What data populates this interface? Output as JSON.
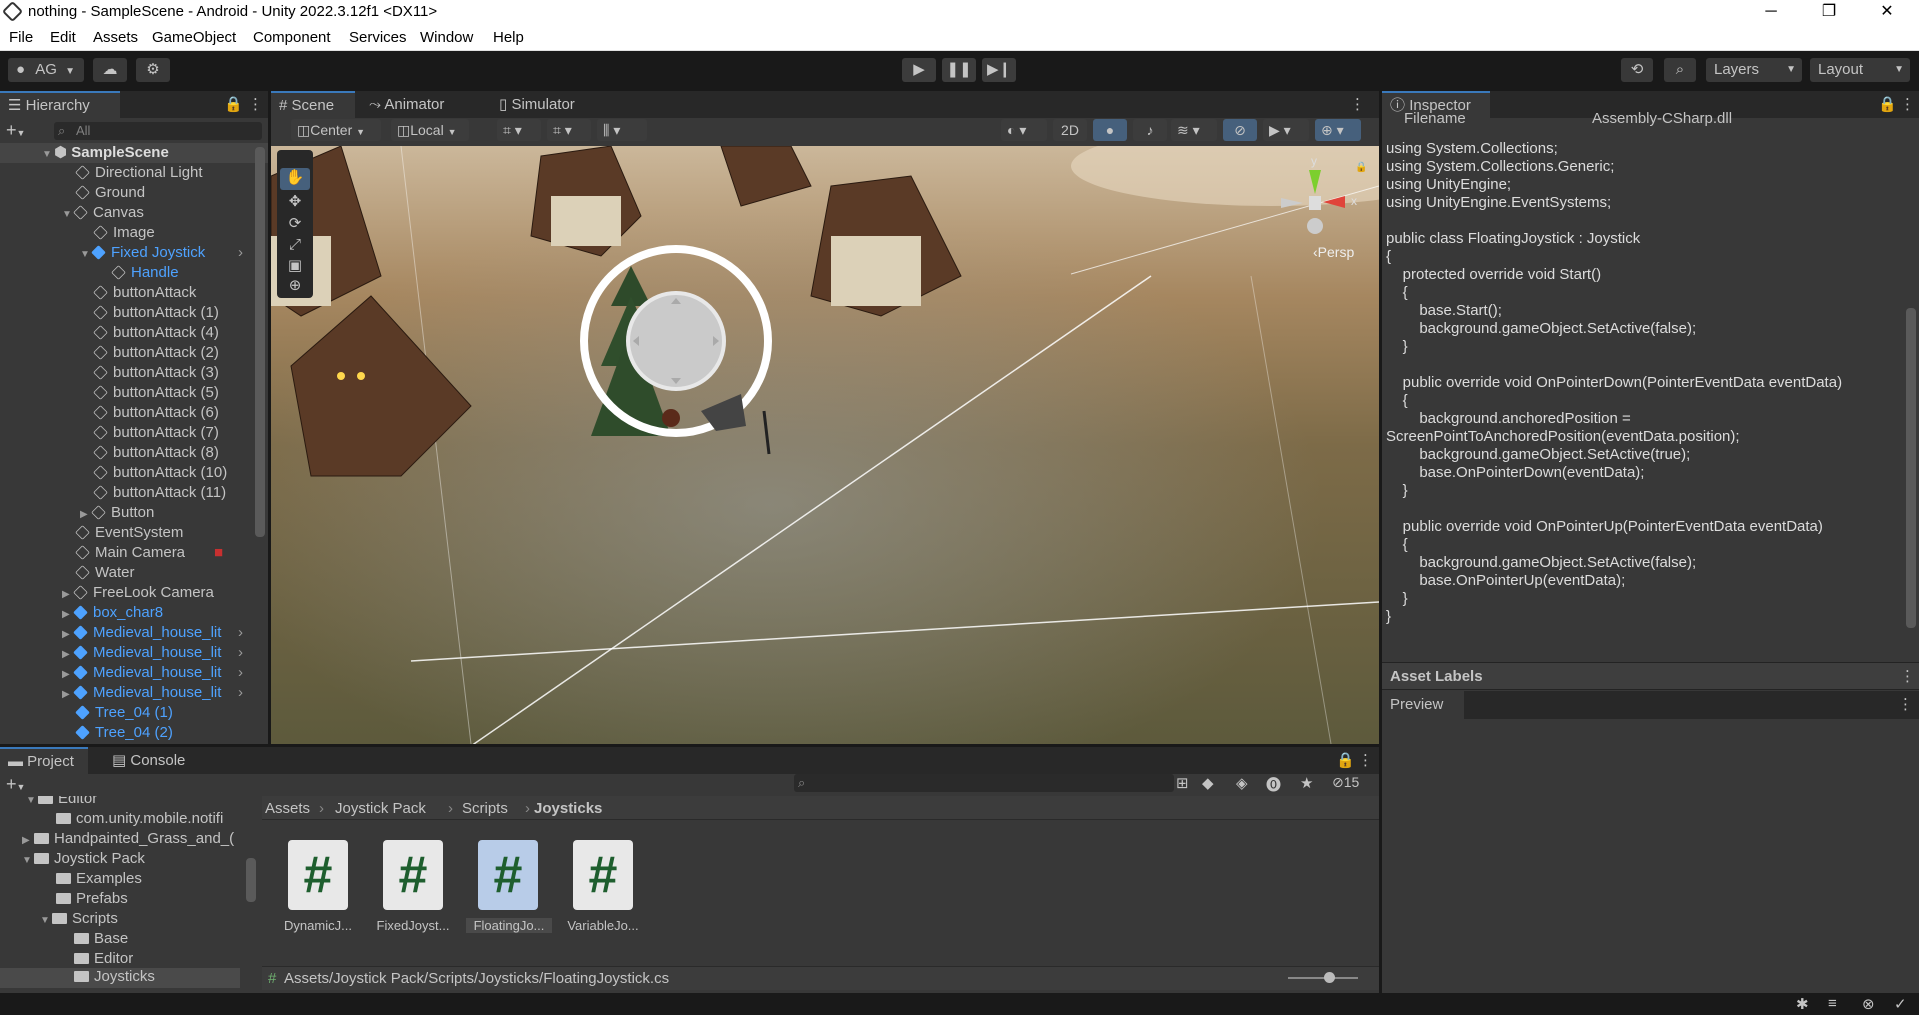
{
  "window": {
    "title": "nothing - SampleScene - Android - Unity 2022.3.12f1 <DX11>",
    "controls": [
      "─",
      "❐",
      "✕"
    ]
  },
  "menu": [
    "File",
    "Edit",
    "Assets",
    "GameObject",
    "Component",
    "Services",
    "Window",
    "Help"
  ],
  "toolbar": {
    "account": "AG",
    "layers": "Layers",
    "layout": "Layout"
  },
  "hierarchy": {
    "tab": "Hierarchy",
    "search_placeholder": "All",
    "items": [
      {
        "label": "SampleScene"
      },
      {
        "label": "Directional Light"
      },
      {
        "label": "Ground"
      },
      {
        "label": "Canvas"
      },
      {
        "label": "Image"
      },
      {
        "label": "Fixed Joystick"
      },
      {
        "label": "Handle"
      },
      {
        "label": "buttonAttack"
      },
      {
        "label": "buttonAttack (1)"
      },
      {
        "label": "buttonAttack (4)"
      },
      {
        "label": "buttonAttack (2)"
      },
      {
        "label": "buttonAttack (3)"
      },
      {
        "label": "buttonAttack (5)"
      },
      {
        "label": "buttonAttack (6)"
      },
      {
        "label": "buttonAttack (7)"
      },
      {
        "label": "buttonAttack (8)"
      },
      {
        "label": "buttonAttack (10)"
      },
      {
        "label": "buttonAttack (11)"
      },
      {
        "label": "Button"
      },
      {
        "label": "EventSystem"
      },
      {
        "label": "Main Camera"
      },
      {
        "label": "Water"
      },
      {
        "label": "FreeLook Camera"
      },
      {
        "label": "box_char8"
      },
      {
        "label": "Medieval_house_lit"
      },
      {
        "label": "Medieval_house_lit"
      },
      {
        "label": "Medieval_house_lit"
      },
      {
        "label": "Medieval_house_lit"
      },
      {
        "label": "Tree_04 (1)"
      },
      {
        "label": "Tree_04 (2)"
      }
    ]
  },
  "scene": {
    "tabs": [
      "Scene",
      "Animator",
      "Simulator"
    ],
    "pivot": "Center",
    "space": "Local",
    "mode_2d": "2D",
    "persp": "Persp",
    "gizmo_y": "y",
    "gizmo_x": "x"
  },
  "inspector": {
    "tab": "Inspector",
    "filename_label": "Filename",
    "filename_value": "Assembly-CSharp.dll",
    "code_lines": [
      "using System.Collections;",
      "using System.Collections.Generic;",
      "using UnityEngine;",
      "using UnityEngine.EventSystems;",
      "",
      "public class FloatingJoystick : Joystick",
      "{",
      "    protected override void Start()",
      "    {",
      "        base.Start();",
      "        background.gameObject.SetActive(false);",
      "    }",
      "",
      "    public override void OnPointerDown(PointerEventData eventData)",
      "    {",
      "        background.anchoredPosition =",
      "ScreenPointToAnchoredPosition(eventData.position);",
      "        background.gameObject.SetActive(true);",
      "        base.OnPointerDown(eventData);",
      "    }",
      "",
      "    public override void OnPointerUp(PointerEventData eventData)",
      "    {",
      "        background.gameObject.SetActive(false);",
      "        base.OnPointerUp(eventData);",
      "    }",
      "}"
    ],
    "asset_labels": "Asset Labels",
    "preview": "Preview"
  },
  "project": {
    "tabs": [
      "Project",
      "Console"
    ],
    "hidden_count": "15",
    "tree": [
      {
        "label": "Editor"
      },
      {
        "label": "com.unity.mobile.notifi"
      },
      {
        "label": "Handpainted_Grass_and_("
      },
      {
        "label": "Joystick Pack"
      },
      {
        "label": "Examples"
      },
      {
        "label": "Prefabs"
      },
      {
        "label": "Scripts"
      },
      {
        "label": "Base"
      },
      {
        "label": "Editor"
      },
      {
        "label": "Joysticks"
      }
    ],
    "breadcrumb": [
      "Assets",
      "Joystick Pack",
      "Scripts",
      "Joysticks"
    ],
    "assets": [
      {
        "label": "DynamicJ...",
        "glyph": "#"
      },
      {
        "label": "FixedJoyst...",
        "glyph": "#"
      },
      {
        "label": "FloatingJo...",
        "glyph": "#"
      },
      {
        "label": "VariableJo...",
        "glyph": "#"
      }
    ],
    "path": "Assets/Joystick Pack/Scripts/Joysticks/FloatingJoystick.cs"
  }
}
